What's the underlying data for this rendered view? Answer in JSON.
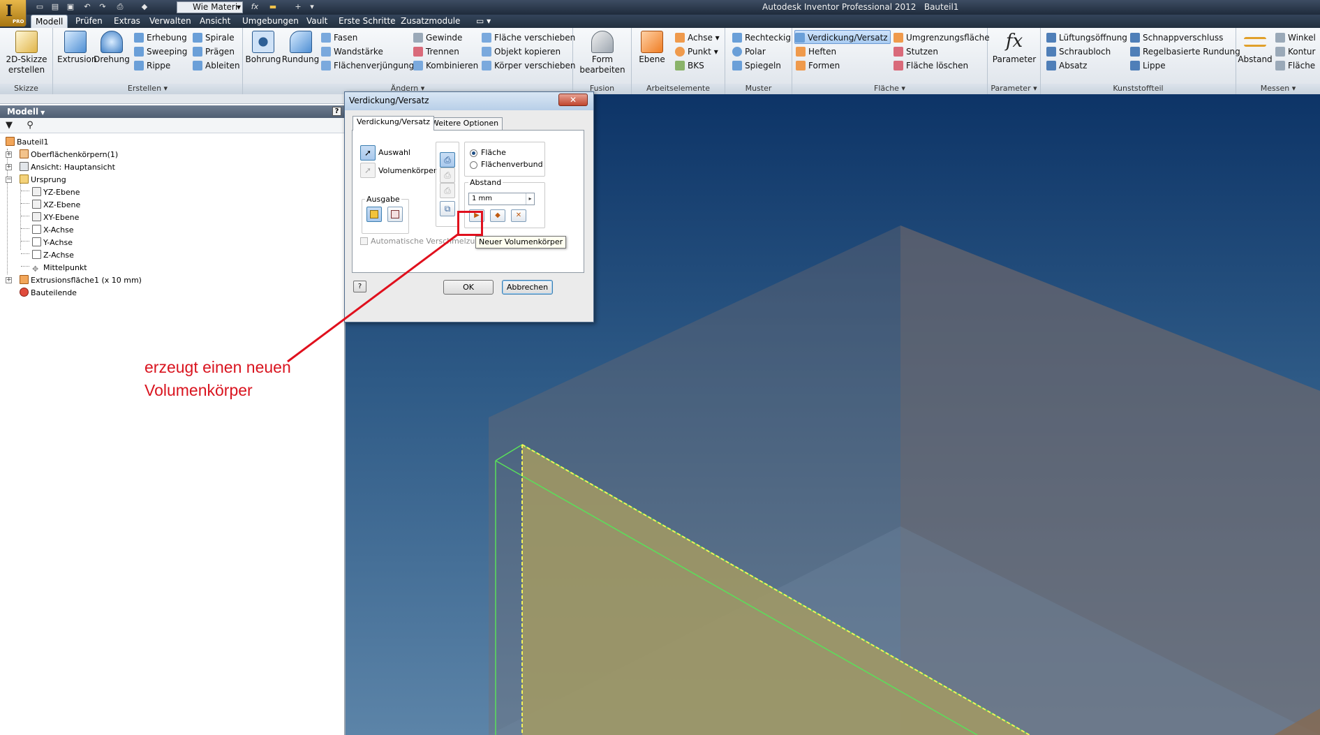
{
  "app": {
    "title": "Autodesk Inventor Professional 2012",
    "document": "Bauteil1",
    "badge": "PRO",
    "letter": "I"
  },
  "quick_access": {
    "combo_value": "Wie Materi",
    "fx_label": "fx"
  },
  "menu_tabs": [
    "Modell",
    "Prüfen",
    "Extras",
    "Verwalten",
    "Ansicht",
    "Umgebungen",
    "Vault",
    "Erste Schritte",
    "Zusatzmodule"
  ],
  "ribbon": {
    "skizze": {
      "label": "Skizze",
      "create_2d_line1": "2D-Skizze",
      "create_2d_line2": "erstellen"
    },
    "erstellen": {
      "label": "Erstellen",
      "extrusion": "Extrusion",
      "drehung": "Drehung",
      "erhebung": "Erhebung",
      "sweeping": "Sweeping",
      "rippe": "Rippe",
      "spirale": "Spirale",
      "praegen": "Prägen",
      "ableiten": "Ableiten"
    },
    "aendern": {
      "label": "Ändern",
      "bohrung": "Bohrung",
      "rundung": "Rundung",
      "fasen": "Fasen",
      "wandstaerke": "Wandstärke",
      "flaechenverjuengung": "Flächenverjüngung",
      "gewinde": "Gewinde",
      "trennen": "Trennen",
      "kombinieren": "Kombinieren",
      "flaeche_verschieben": "Fläche verschieben",
      "objekt_kopieren": "Objekt kopieren",
      "koerper_verschieben": "Körper verschieben"
    },
    "fusion": {
      "label": "Fusion",
      "form_line1": "Form",
      "form_line2": "bearbeiten"
    },
    "arbeitselemente": {
      "label": "Arbeitselemente",
      "ebene": "Ebene",
      "achse": "Achse",
      "punkt": "Punkt",
      "bks": "BKS"
    },
    "muster": {
      "label": "Muster",
      "rechteckig": "Rechteckig",
      "polar": "Polar",
      "spiegeln": "Spiegeln"
    },
    "flaeche": {
      "label": "Fläche",
      "verdickung": "Verdickung/Versatz",
      "heften": "Heften",
      "formen": "Formen",
      "umgrenzung": "Umgrenzungsfläche",
      "stutzen": "Stutzen",
      "flaeche_loeschen": "Fläche löschen"
    },
    "parameter": {
      "label": "Parameter",
      "parameter": "Parameter",
      "fx": "fx"
    },
    "kunststoffteil": {
      "label": "Kunststoffteil",
      "lueftung": "Lüftungsöffnung",
      "schraubloch": "Schraubloch",
      "absatz": "Absatz",
      "schnapp": "Schnappverschluss",
      "regelbasiert": "Regelbasierte Rundung",
      "lippe": "Lippe"
    },
    "messen": {
      "label": "Messen",
      "abstand": "Abstand",
      "winkel": "Winkel",
      "kontur": "Kontur",
      "flaeche": "Fläche"
    }
  },
  "browser": {
    "title": "Modell",
    "tree": [
      {
        "label": "Bauteil1"
      },
      {
        "label": "Oberflächenkörpern(1)"
      },
      {
        "label": "Ansicht: Hauptansicht"
      },
      {
        "label": "Ursprung"
      },
      {
        "label": "YZ-Ebene"
      },
      {
        "label": "XZ-Ebene"
      },
      {
        "label": "XY-Ebene"
      },
      {
        "label": "X-Achse"
      },
      {
        "label": "Y-Achse"
      },
      {
        "label": "Z-Achse"
      },
      {
        "label": "Mittelpunkt"
      },
      {
        "label": "Extrusionsfläche1 (x 10 mm)"
      },
      {
        "label": "Bauteilende"
      }
    ]
  },
  "dialog": {
    "title": "Verdickung/Versatz",
    "close": "✕",
    "tabs": [
      "Verdickung/Versatz",
      "Weitere Optionen"
    ],
    "auswahl": "Auswahl",
    "volumenkoerper": "Volumenkörper",
    "ausgabe": "Ausgabe",
    "flaeche": "Fläche",
    "flaechenverbund": "Flächenverbund",
    "abstand": "Abstand",
    "distance_value": "1 mm",
    "auto_merge": "Automatische Verschmelzung",
    "ok": "OK",
    "cancel": "Abbrechen",
    "help": "?",
    "tooltip": "Neuer Volumenkörper",
    "selected_option": "Fläche"
  },
  "annotation": {
    "line1": "erzeugt einen neuen",
    "line2": "Volumenkörper",
    "color": "#d9141f"
  },
  "colors": {
    "title_bar": "#2b3a4e",
    "viewport_top": "#0d3467",
    "viewport_bottom": "#5c84a8",
    "face_fill": "#a39a63",
    "face_edge": "#f3f35a",
    "highlight": "#e0101d"
  }
}
